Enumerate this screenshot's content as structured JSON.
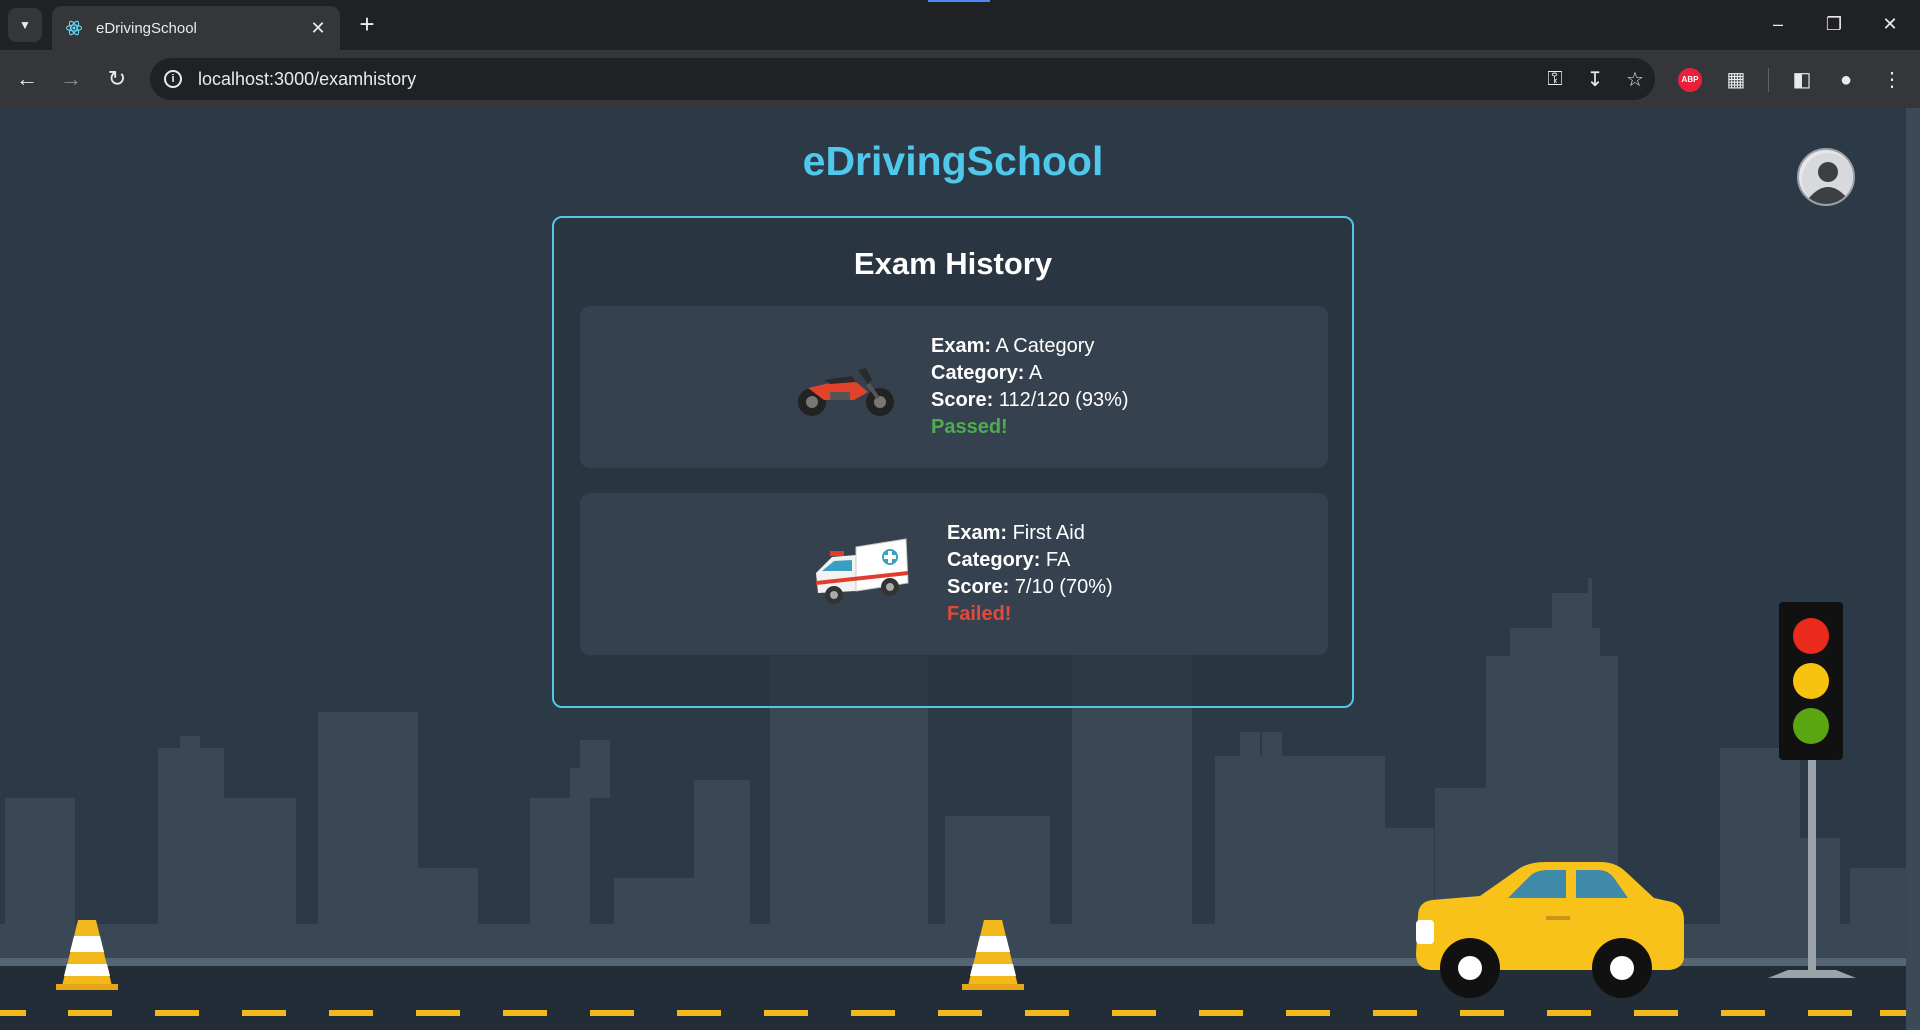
{
  "browser": {
    "tab_title": "eDrivingSchool",
    "url": "localhost:3000/examhistory",
    "abp_label": "ABP"
  },
  "page": {
    "brand": "eDrivingSchool",
    "heading": "Exam History"
  },
  "labels": {
    "exam": "Exam:",
    "category": "Category:",
    "score": "Score:"
  },
  "exams": [
    {
      "exam": "A Category",
      "category": "A",
      "score": "112/120 (93%)",
      "status": "Passed!",
      "icon": "motorcycle-icon"
    },
    {
      "exam": "First Aid",
      "category": "FA",
      "score": "7/10 (70%)",
      "status": "Failed!",
      "icon": "ambulance-icon"
    }
  ],
  "colors": {
    "brand": "#4fc8ec",
    "passed": "#4cae4f",
    "failed": "#e04b3a",
    "background": "#2c3a47"
  }
}
